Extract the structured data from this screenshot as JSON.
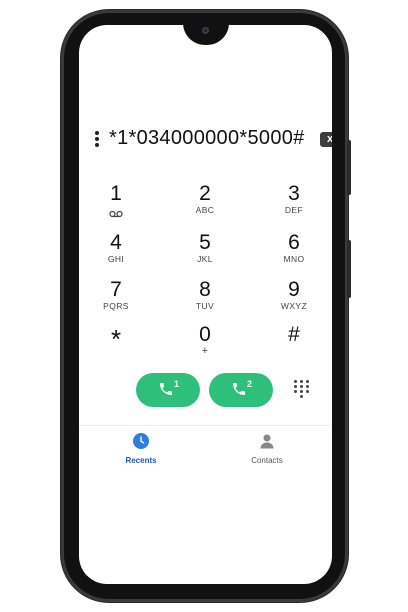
{
  "dialer": {
    "number": "*1*034000000*5000#",
    "backspace_label": "x"
  },
  "keypad": [
    {
      "digit": "1",
      "letters": "voicemail-icon"
    },
    {
      "digit": "2",
      "letters": "ABC"
    },
    {
      "digit": "3",
      "letters": "DEF"
    },
    {
      "digit": "4",
      "letters": "GHI"
    },
    {
      "digit": "5",
      "letters": "JKL"
    },
    {
      "digit": "6",
      "letters": "MNO"
    },
    {
      "digit": "7",
      "letters": "PQRS"
    },
    {
      "digit": "8",
      "letters": "TUV"
    },
    {
      "digit": "9",
      "letters": "WXYZ"
    },
    {
      "digit": "*",
      "letters": ""
    },
    {
      "digit": "0",
      "letters": "+"
    },
    {
      "digit": "#",
      "letters": ""
    }
  ],
  "calls": {
    "sim1": "1",
    "sim2": "2",
    "color": "#2ebf7a"
  },
  "nav": {
    "recents_label": "Recents",
    "contacts_label": "Contacts",
    "active_color": "#1a56c4",
    "inactive_color": "#555555"
  }
}
